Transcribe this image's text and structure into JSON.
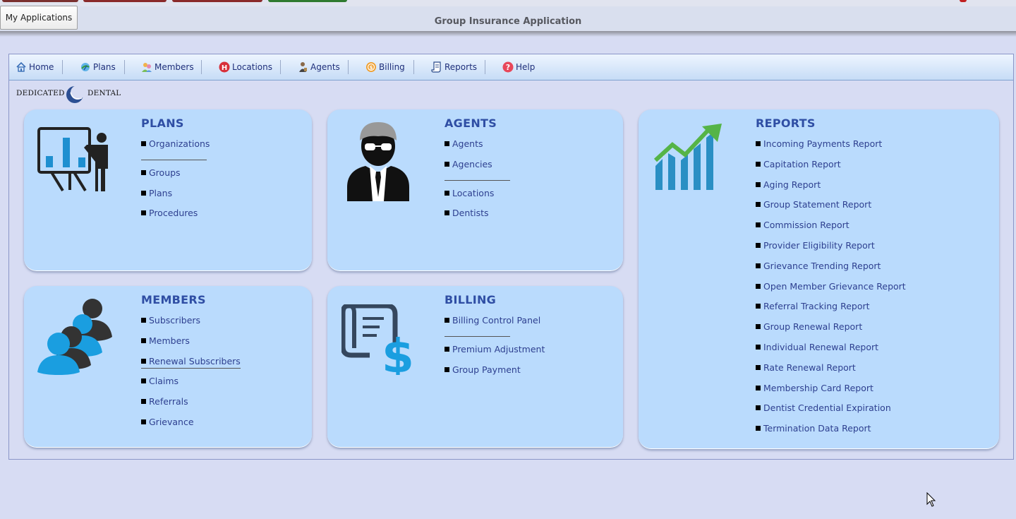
{
  "window": {
    "my_applications_label": "My Applications",
    "title": "Group Insurance Application"
  },
  "nav": {
    "items": [
      {
        "label": "Home",
        "icon": "home-icon"
      },
      {
        "label": "Plans",
        "icon": "plans-icon"
      },
      {
        "label": "Members",
        "icon": "members-icon"
      },
      {
        "label": "Locations",
        "icon": "locations-icon"
      },
      {
        "label": "Agents",
        "icon": "agents-icon"
      },
      {
        "label": "Billing",
        "icon": "billing-icon"
      },
      {
        "label": "Reports",
        "icon": "reports-icon"
      },
      {
        "label": "Help",
        "icon": "help-icon"
      }
    ]
  },
  "logo": {
    "left_text": "DEDICATED",
    "right_text": "DENTAL"
  },
  "cards": {
    "plans": {
      "title": "PLANS",
      "links": [
        "Organizations",
        "Groups",
        "Plans",
        "Procedures"
      ]
    },
    "agents": {
      "title": "AGENTS",
      "links": [
        "Agents",
        "Agencies",
        "Locations",
        "Dentists"
      ]
    },
    "reports": {
      "title": "REPORTS",
      "links": [
        "Incoming Payments Report",
        "Capitation Report",
        "Aging Report",
        "Group Statement Report",
        "Commission Report",
        "Provider Eligibility Report",
        "Grievance Trending Report",
        "Open Member Grievance Report",
        "Referral Tracking Report",
        "Group Renewal Report",
        "Individual Renewal Report",
        "Rate Renewal Report",
        "Membership Card Report",
        "Dentist Credential Expiration",
        "Termination Data Report"
      ]
    },
    "members": {
      "title": "MEMBERS",
      "links": [
        "Subscribers",
        "Members",
        "Renewal Subscribers",
        "Claims",
        "Referrals",
        "Grievance"
      ]
    },
    "billing": {
      "title": "BILLING",
      "links": [
        "Billing Control Panel",
        "Premium Adjustment",
        "Group Payment"
      ]
    }
  },
  "colors": {
    "page_bg": "#d7dcf3",
    "card_bg": "#badbfd",
    "heading": "#2f4ea4",
    "link": "#2d3f8f",
    "report_icon_bar": "#2a8fc4",
    "report_icon_arrow": "#55b447",
    "members_icon_blue": "#1a9ee0"
  }
}
